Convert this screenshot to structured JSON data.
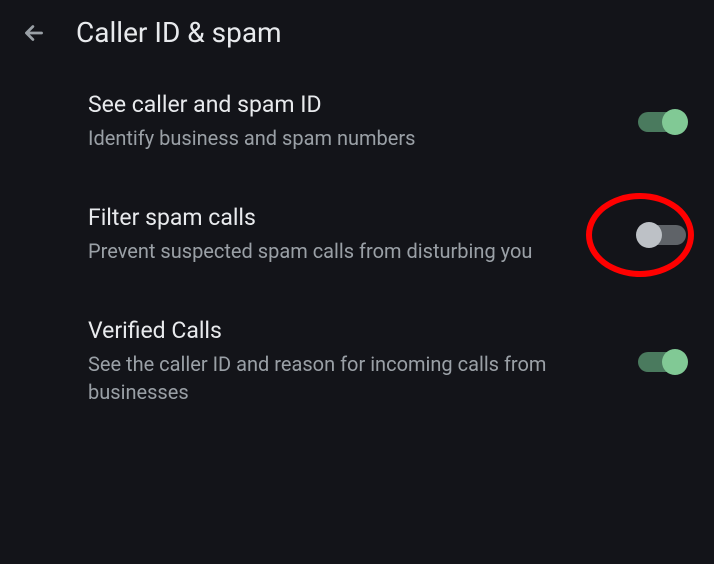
{
  "header": {
    "title": "Caller ID & spam"
  },
  "settings": [
    {
      "title": "See caller and spam ID",
      "description": "Identify business and spam numbers",
      "enabled": true,
      "highlighted": false
    },
    {
      "title": "Filter spam calls",
      "description": "Prevent suspected spam calls from disturbing you",
      "enabled": false,
      "highlighted": true
    },
    {
      "title": "Verified Calls",
      "description": "See the caller ID and reason for incoming calls from businesses",
      "enabled": true,
      "highlighted": false
    }
  ],
  "colors": {
    "background": "#131419",
    "text_primary": "#e8eaed",
    "text_secondary": "#9aa0a6",
    "toggle_on_track": "#4a7a5e",
    "toggle_on_thumb": "#81c995",
    "toggle_off_track": "#5f6368",
    "toggle_off_thumb": "#bdc1c6",
    "highlight": "#ff0000"
  }
}
